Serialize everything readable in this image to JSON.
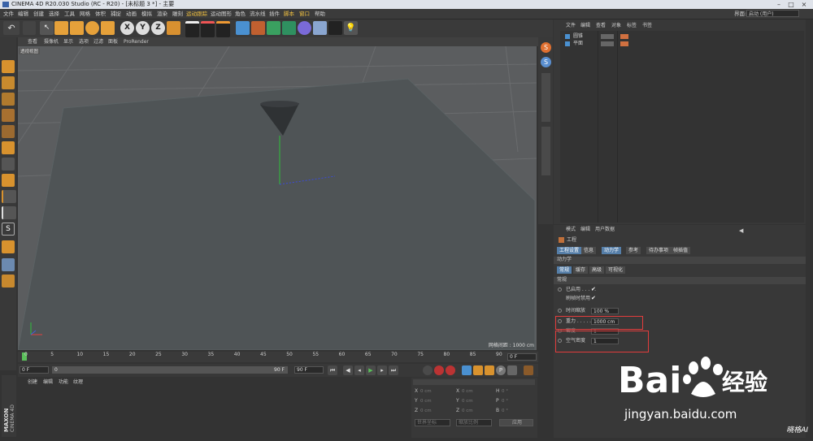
{
  "window": {
    "title": "CINEMA 4D R20.030 Studio (RC - R20) - [未标题 3 *] - 主要"
  },
  "menu": {
    "items": [
      "文件",
      "编辑",
      "创建",
      "选择",
      "工具",
      "网格",
      "体积",
      "捕捉",
      "动画",
      "模拟",
      "渲染",
      "雕刻",
      "运动跟踪",
      "运动图形",
      "角色",
      "流水线",
      "插件",
      "脚本",
      "窗口",
      "帮助"
    ],
    "layout_label": "界面:",
    "layout_value": "启动 (用户)"
  },
  "toolbar": {
    "axis_labels": [
      "X",
      "Y",
      "Z"
    ]
  },
  "viewport": {
    "menu": [
      "查看",
      "摄像机",
      "显示",
      "选项",
      "过滤",
      "面板",
      "ProRender"
    ],
    "tag": "透视视图",
    "grid_info": "网格间距 : 1000 cm"
  },
  "object_manager": {
    "tabs": [
      "文件",
      "编辑",
      "查看",
      "对象",
      "标签",
      "书签"
    ],
    "objects": [
      "圆锥",
      "平面"
    ]
  },
  "attributes": {
    "header_tabs": [
      "模式",
      "编辑",
      "用户数据"
    ],
    "section": "工程",
    "main_tabs": [
      "工程设置",
      "信息",
      "动力学",
      "参考",
      "待办事项",
      "帧插值"
    ],
    "active_main_tab": "动力学",
    "sub_header": "动力学",
    "sub_tabs": [
      "常规",
      "缓存",
      "高级",
      "可视化"
    ],
    "group": "常规",
    "fields": {
      "enabled_label": "已启用 . . . . .",
      "disable_on_scrub_label": "刷帧时禁用",
      "time_scale_label": "时间缩放",
      "time_scale_value": "100 %",
      "gravity_label": "重力 . . . . .",
      "gravity_value": "1000 cm",
      "density_label": "密度",
      "density_value": "1",
      "air_density_label": "空气密度",
      "air_density_value": "1"
    }
  },
  "timeline": {
    "ticks": [
      "0",
      "5",
      "10",
      "15",
      "20",
      "25",
      "30",
      "35",
      "40",
      "45",
      "50",
      "55",
      "60",
      "65",
      "70",
      "75",
      "80",
      "85",
      "90"
    ],
    "current_frame": "0 F",
    "start": "0 F",
    "range_start": "0",
    "range_end": "90 F",
    "end": "90 F"
  },
  "material_manager": {
    "menu": [
      "创建",
      "编辑",
      "功能",
      "纹理"
    ]
  },
  "coordinates": {
    "rows": [
      {
        "axis": "X",
        "pos": "0 cm",
        "axis2": "X",
        "size": "0 cm",
        "rot_label": "H",
        "rot": "0 °"
      },
      {
        "axis": "Y",
        "pos": "0 cm",
        "axis2": "Y",
        "size": "0 cm",
        "rot_label": "P",
        "rot": "0 °"
      },
      {
        "axis": "Z",
        "pos": "0 cm",
        "axis2": "Z",
        "size": "0 cm",
        "rot_label": "B",
        "rot": "0 °"
      }
    ],
    "mode": "世界坐标",
    "scale_mode": "缩放比例",
    "apply": "应用"
  },
  "branding": {
    "maxon": "MAXON",
    "product": "CINEMA 4D"
  },
  "watermark": {
    "baidu_text": "Bai",
    "baidu_cn": "经验",
    "url": "jingyan.baidu.com",
    "author": "晓格AI"
  },
  "colors": {
    "accent": "#557ea8",
    "highlight": "#e23c3c",
    "menu_highlight": "#f0c040"
  }
}
